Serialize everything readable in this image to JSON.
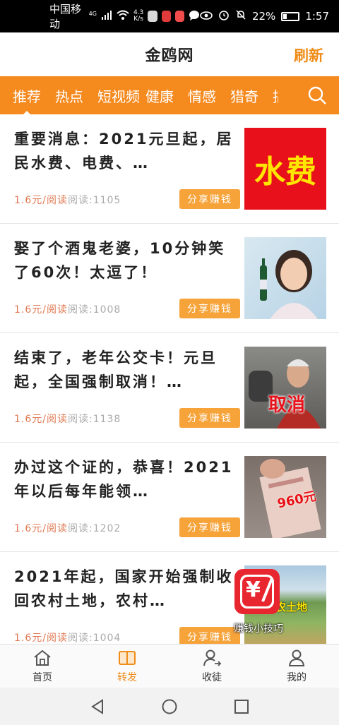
{
  "status_bar": {
    "carrier": "中国移动",
    "network_badge": "4G",
    "speed_value": "4.3",
    "speed_unit": "K/s",
    "battery": "22%",
    "time": "1:57"
  },
  "header": {
    "title": "金鸥网",
    "refresh_label": "刷新"
  },
  "tabs": [
    "推荐",
    "热点",
    "短视频",
    "健康",
    "情感",
    "猎奇",
    "搞"
  ],
  "articles": [
    {
      "title": "重要消息：2021元旦起，居民水费、电费、…",
      "price": "1.6元/阅读",
      "reads": "阅读:1105",
      "share": "分享赚钱",
      "thumb_text": "水费"
    },
    {
      "title": "娶了个酒鬼老婆，10分钟笑了60次！太逗了！",
      "price": "1.6元/阅读",
      "reads": "阅读:1008",
      "share": "分享赚钱",
      "thumb_text": ""
    },
    {
      "title": "结束了，老年公交卡！元旦起，全国强制取消！…",
      "price": "1.6元/阅读",
      "reads": "阅读:1138",
      "share": "分享赚钱",
      "thumb_text": "取消"
    },
    {
      "title": "办过这个证的，恭喜！2021年以后每年能领…",
      "price": "1.6元/阅读",
      "reads": "阅读:1202",
      "share": "分享赚钱",
      "thumb_text": "960元"
    },
    {
      "title": "2021年起，国家开始强制收回农村土地，农村…",
      "price": "1.6元/阅读",
      "reads": "阅读:1004",
      "share": "分享赚钱",
      "thumb_text": "农土地"
    }
  ],
  "floating_widget": {
    "label": "赚钱小技巧",
    "icon_text": "¥"
  },
  "bottom_nav": [
    {
      "label": "首页",
      "icon": "home-icon"
    },
    {
      "label": "转发",
      "icon": "book-icon"
    },
    {
      "label": "收徒",
      "icon": "user-add-icon"
    },
    {
      "label": "我的",
      "icon": "person-icon"
    }
  ],
  "colors": {
    "accent": "#f58a1f",
    "share_button": "#f6a33a",
    "price_text": "#e07a53"
  }
}
